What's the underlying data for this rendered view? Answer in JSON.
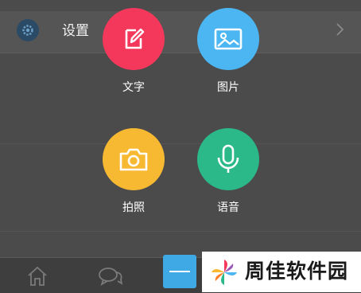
{
  "background": {
    "settings_label": "设置",
    "tabs": [
      {
        "name": "home-icon"
      },
      {
        "name": "chat-icon"
      }
    ]
  },
  "actions": [
    {
      "id": "text",
      "label": "文字",
      "color": "#f4385b",
      "icon": "edit-icon"
    },
    {
      "id": "image",
      "label": "图片",
      "color": "#4bb6f2",
      "icon": "image-icon"
    },
    {
      "id": "photo",
      "label": "拍照",
      "color": "#f7b932",
      "icon": "camera-icon"
    },
    {
      "id": "voice",
      "label": "语音",
      "color": "#2bb98a",
      "icon": "microphone-icon"
    }
  ],
  "close_button": {
    "icon": "minus-icon"
  },
  "watermark": {
    "text": "周佳软件园"
  },
  "colors": {
    "overlay": "#4b4b4b",
    "close_button": "#3fa9e6"
  }
}
